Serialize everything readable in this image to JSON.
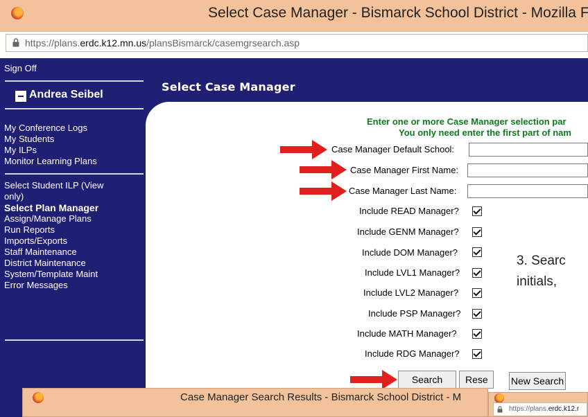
{
  "window": {
    "title": "Select Case Manager - Bismarck School District - Mozilla Fi",
    "url_prefix": "https://plans.",
    "url_domain": "erdc.k12.mn.us",
    "url_path": "/plansBismarck/casemgrsearch.asp"
  },
  "sidebar": {
    "sign_off": "Sign Off",
    "user_name": "Andrea Seibel",
    "group1": [
      "My Conference Logs",
      "My Students",
      "My ILPs",
      "Monitor Learning Plans"
    ],
    "select_student": "Select Student ILP (View only)",
    "select_plan_manager": "Select Plan Manager",
    "group2": [
      "Assign/Manage Plans",
      "Run Reports",
      "Imports/Exports",
      "Staff Maintenance",
      "District Maintenance",
      "System/Template Maint",
      "Error Messages"
    ]
  },
  "page": {
    "title": "Select Case Manager",
    "instruction_line1": "Enter one or more Case Manager selection par",
    "instruction_line2": "You only need enter the first part of nam"
  },
  "form": {
    "default_school_label": "Case Manager Default School:",
    "first_name_label": "Case Manager First Name:",
    "last_name_label": "Case Manager Last Name:",
    "checkboxes": [
      {
        "label": "Include READ Manager?",
        "checked": true
      },
      {
        "label": "Include GENM Manager?",
        "checked": true
      },
      {
        "label": "Include DOM Manager?",
        "checked": true
      },
      {
        "label": "Include LVL1 Manager?",
        "checked": true
      },
      {
        "label": "Include LVL2 Manager?",
        "checked": true
      },
      {
        "label": "Include PSP Manager?",
        "checked": true
      },
      {
        "label": "Include MATH Manager?",
        "checked": true
      },
      {
        "label": "Include RDG Manager?",
        "checked": true
      }
    ],
    "search_button": "Search",
    "reset_button": "Rese",
    "new_search_button": "New Search"
  },
  "annotation": {
    "line1": "3. Searc",
    "line2": "initials,"
  },
  "popup_results": {
    "title": "Case Manager Search Results - Bismarck School District - M"
  },
  "popup_small": {
    "url_prefix": "https://plans.",
    "url_domain": "erdc.k12.r"
  },
  "colors": {
    "titlebar": "#f2c29b",
    "nav_background": "#1f1f73",
    "instruction_green": "#0f7a1e",
    "arrow_red": "#e01f1f"
  }
}
